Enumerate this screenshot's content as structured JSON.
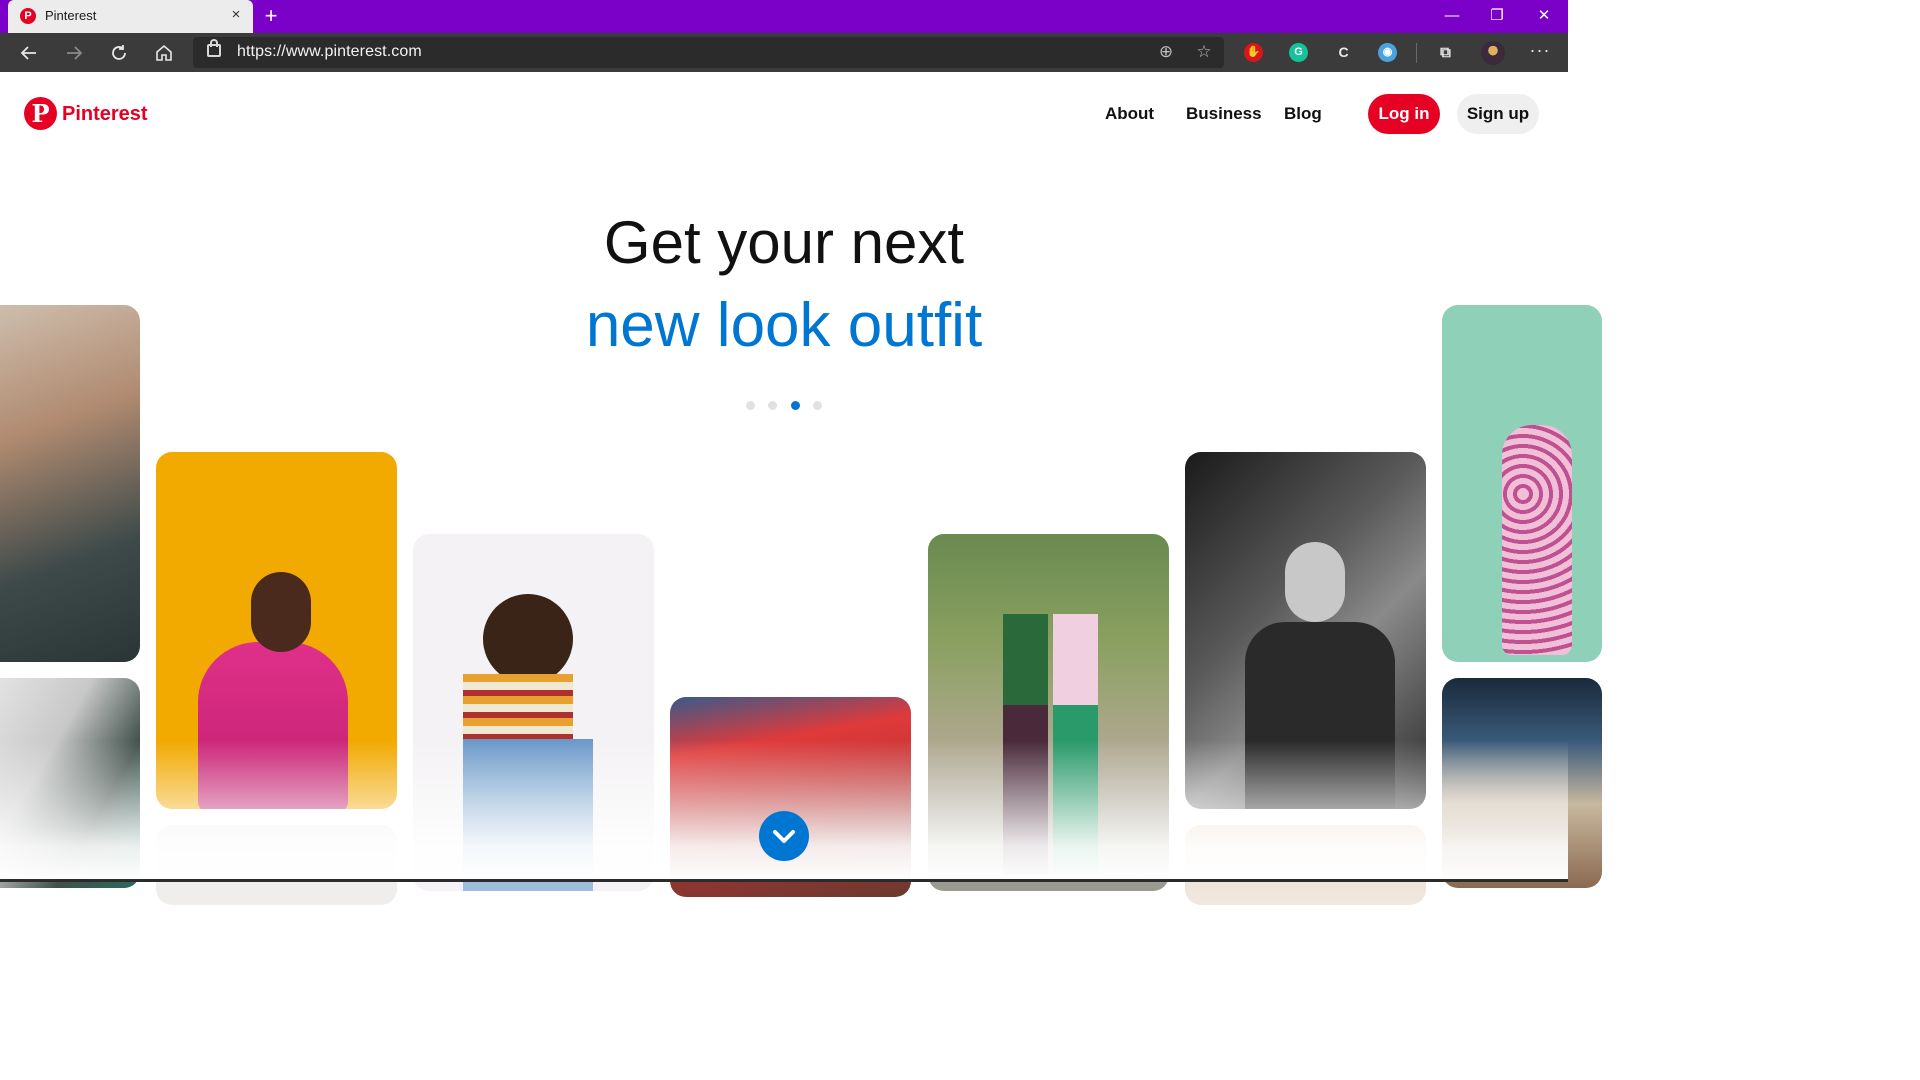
{
  "browser": {
    "tab_title": "Pinterest",
    "tab_favicon_letter": "P",
    "tab_close": "×",
    "new_tab": "+",
    "url": "https://www.pinterest.com",
    "window_controls": {
      "minimize": "—",
      "restore": "❐",
      "close": "✕"
    },
    "toolbar_icons": [
      "back-icon",
      "forward-icon",
      "refresh-icon",
      "home-icon",
      "lock-icon",
      "add-icon",
      "favorites-icon",
      "extension-red-icon",
      "grammarly-icon",
      "extension-c-icon",
      "extension-search-icon",
      "collections-icon",
      "profile-avatar",
      "more-icon"
    ]
  },
  "header": {
    "logo_text": "Pinterest",
    "nav": {
      "about": "About",
      "business": "Business",
      "blog": "Blog"
    },
    "login": "Log in",
    "signup": "Sign up",
    "brand_color": "#e60023"
  },
  "hero": {
    "line1": "Get your next",
    "line2": "new look outfit",
    "accent_color": "#0076d3",
    "carousel": {
      "total": 4,
      "active_index": 2
    }
  },
  "pins": {
    "count": 12,
    "subjects": [
      "woman in plaid coat",
      "striped sleeves",
      "man in pink sweater on yellow",
      "woman in striped tee and jeans",
      "red fabric portrait",
      "two women street style",
      "man in black and white",
      "woman in floral dress on teal",
      "patterned fabrics"
    ]
  }
}
